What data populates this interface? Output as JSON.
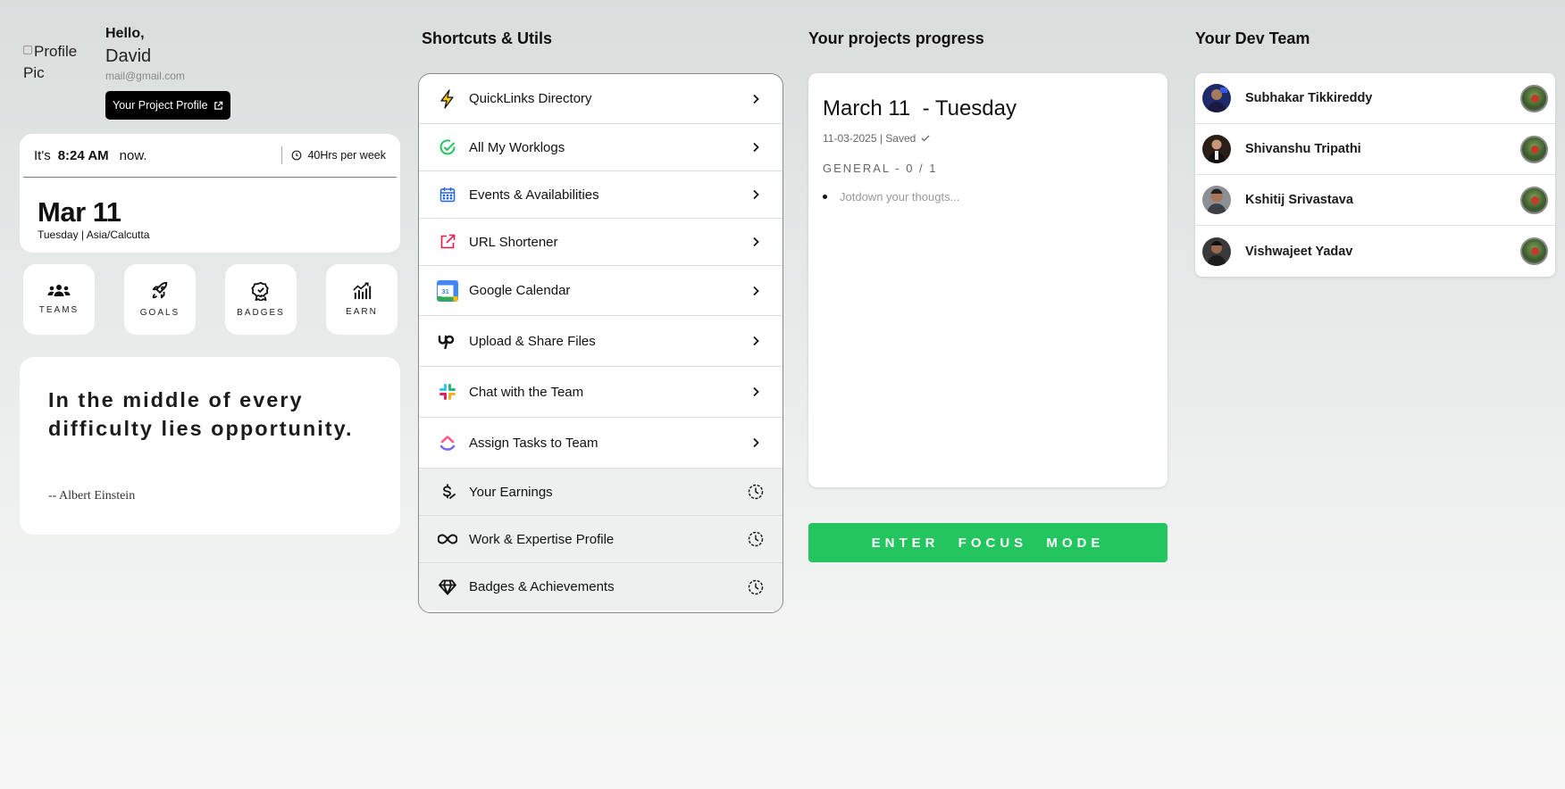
{
  "profile": {
    "avatar_alt": "Profile Pic",
    "greeting": "Hello,",
    "name": "David",
    "email": "mail@gmail.com",
    "project_profile_button": "Your Project Profile"
  },
  "clock": {
    "prefix": "It's",
    "time": "8:24 AM",
    "suffix": "now.",
    "hours_per_week": "40Hrs per week",
    "date": "Mar 11",
    "day_tz": "Tuesday | Asia/Calcutta"
  },
  "tiles": [
    {
      "label": "TEAMS",
      "icon": "users-icon"
    },
    {
      "label": "GOALS",
      "icon": "rocket-icon"
    },
    {
      "label": "BADGES",
      "icon": "badge-icon"
    },
    {
      "label": "EARN",
      "icon": "chart-icon"
    }
  ],
  "quote": {
    "text": "In the middle of every difficulty lies opportunity.",
    "author": "-- Albert Einstein"
  },
  "shortcuts": {
    "title": "Shortcuts & Utils",
    "items": [
      {
        "label": "QuickLinks Directory",
        "icon": "lightning-icon"
      },
      {
        "label": "All My Worklogs",
        "icon": "check-circle-icon"
      },
      {
        "label": "Events & Availabilities",
        "icon": "calendar-icon"
      },
      {
        "label": "URL Shortener",
        "icon": "external-link-icon"
      },
      {
        "label": "Google Calendar",
        "icon": "google-calendar-icon",
        "badge": "31"
      },
      {
        "label": "Upload & Share Files",
        "icon": "upwork-icon"
      },
      {
        "label": "Chat with the Team",
        "icon": "slack-icon"
      },
      {
        "label": "Assign Tasks to Team",
        "icon": "clickup-icon"
      },
      {
        "label": "Your Earnings",
        "icon": "dollar-icon"
      },
      {
        "label": "Work & Expertise Profile",
        "icon": "infinity-icon"
      },
      {
        "label": "Badges & Achievements",
        "icon": "gem-icon"
      }
    ]
  },
  "progress": {
    "title": "Your projects progress",
    "date_heading": "March 11  - Tuesday",
    "meta": "11-03-2025 | Saved",
    "general": "GENERAL - 0 / 1",
    "placeholder": "Jotdown your thougts...",
    "focus_button": "ENTER FOCUS MODE"
  },
  "team": {
    "title": "Your Dev Team",
    "members": [
      {
        "name": "Subhakar Tikkireddy"
      },
      {
        "name": "Shivanshu Tripathi"
      },
      {
        "name": "Kshitij Srivastava"
      },
      {
        "name": "Vishwajeet Yadav"
      }
    ]
  },
  "colors": {
    "accent_green": "#22c55e",
    "background": "#e3e6e5",
    "card": "#ffffff"
  }
}
